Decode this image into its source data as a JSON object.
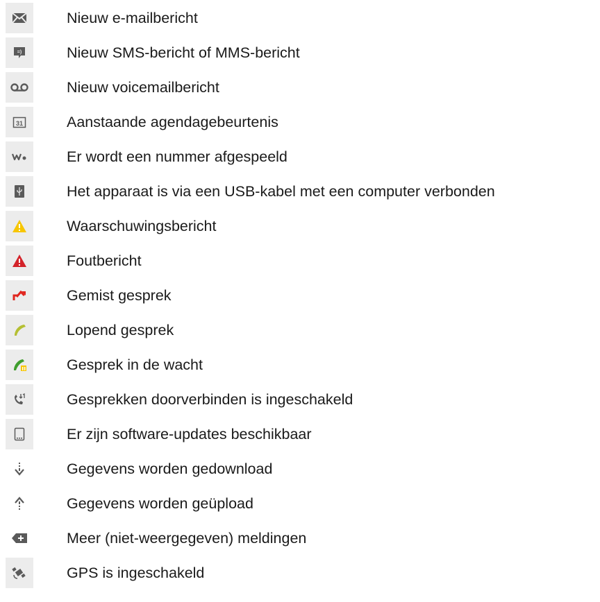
{
  "items": [
    {
      "icon": "email-icon",
      "label": "Nieuw e-mailbericht"
    },
    {
      "icon": "sms-mms-icon",
      "label": "Nieuw SMS-bericht of MMS-bericht"
    },
    {
      "icon": "voicemail-icon",
      "label": "Nieuw voicemailbericht"
    },
    {
      "icon": "calendar-icon",
      "label": "Aanstaande agendagebeurtenis"
    },
    {
      "icon": "walkman-icon",
      "label": "Er wordt een nummer afgespeeld"
    },
    {
      "icon": "usb-icon",
      "label": "Het apparaat is via een USB-kabel met een computer verbonden"
    },
    {
      "icon": "warning-icon",
      "label": "Waarschuwingsbericht"
    },
    {
      "icon": "error-icon",
      "label": "Foutbericht"
    },
    {
      "icon": "missed-call-icon",
      "label": "Gemist gesprek"
    },
    {
      "icon": "ongoing-call-icon",
      "label": "Lopend gesprek"
    },
    {
      "icon": "call-on-hold-icon",
      "label": "Gesprek in de wacht"
    },
    {
      "icon": "call-forward-icon",
      "label": "Gesprekken doorverbinden is ingeschakeld"
    },
    {
      "icon": "software-update-icon",
      "label": "Er zijn software-updates beschikbaar"
    },
    {
      "icon": "download-icon",
      "label": "Gegevens worden gedownload"
    },
    {
      "icon": "upload-icon",
      "label": "Gegevens worden geüpload"
    },
    {
      "icon": "more-notifications-icon",
      "label": "Meer (niet-weergegeven) meldingen"
    },
    {
      "icon": "gps-icon",
      "label": "GPS is ingeschakeld"
    }
  ],
  "colors": {
    "warning": "#f7c600",
    "error": "#d3232a",
    "missed": "#e0261f",
    "call": "#b5bf33",
    "hold_green": "#3f9e2e",
    "icon_gray": "#5a5a5a"
  }
}
